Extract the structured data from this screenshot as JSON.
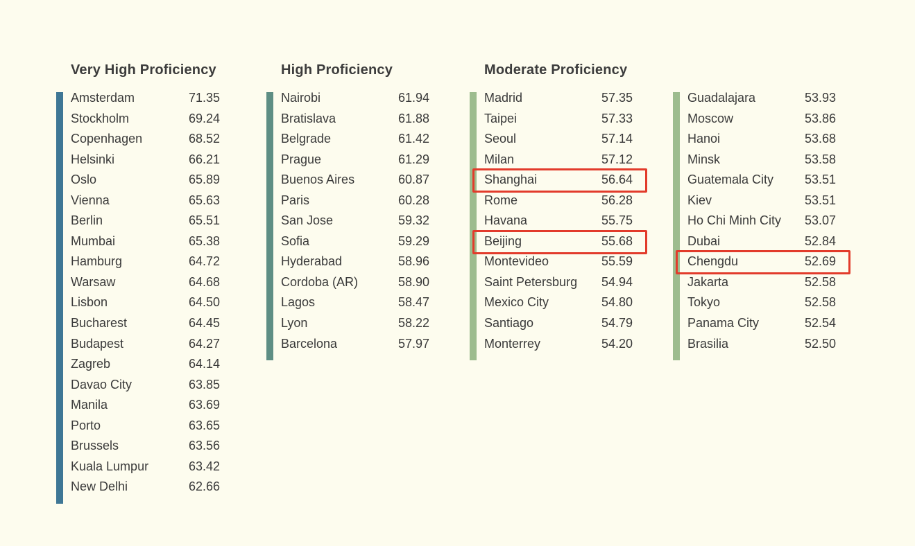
{
  "colors": {
    "very_high": "#3f7795",
    "high": "#5e8e84",
    "moderate": "#9dbc8e",
    "highlight": "#e23b2b",
    "background": "#fdfcee"
  },
  "groups": {
    "very_high": {
      "title": "Very High Proficiency",
      "rows": [
        {
          "city": "Amsterdam",
          "score": "71.35"
        },
        {
          "city": "Stockholm",
          "score": "69.24"
        },
        {
          "city": "Copenhagen",
          "score": "68.52"
        },
        {
          "city": "Helsinki",
          "score": "66.21"
        },
        {
          "city": "Oslo",
          "score": "65.89"
        },
        {
          "city": "Vienna",
          "score": "65.63"
        },
        {
          "city": "Berlin",
          "score": "65.51"
        },
        {
          "city": "Mumbai",
          "score": "65.38"
        },
        {
          "city": "Hamburg",
          "score": "64.72"
        },
        {
          "city": "Warsaw",
          "score": "64.68"
        },
        {
          "city": "Lisbon",
          "score": "64.50"
        },
        {
          "city": "Bucharest",
          "score": "64.45"
        },
        {
          "city": "Budapest",
          "score": "64.27"
        },
        {
          "city": "Zagreb",
          "score": "64.14"
        },
        {
          "city": "Davao City",
          "score": "63.85"
        },
        {
          "city": "Manila",
          "score": "63.69"
        },
        {
          "city": "Porto",
          "score": "63.65"
        },
        {
          "city": "Brussels",
          "score": "63.56"
        },
        {
          "city": "Kuala Lumpur",
          "score": "63.42"
        },
        {
          "city": "New Delhi",
          "score": "62.66"
        }
      ]
    },
    "high": {
      "title": "High Proficiency",
      "rows": [
        {
          "city": "Nairobi",
          "score": "61.94"
        },
        {
          "city": "Bratislava",
          "score": "61.88"
        },
        {
          "city": "Belgrade",
          "score": "61.42"
        },
        {
          "city": "Prague",
          "score": "61.29"
        },
        {
          "city": "Buenos Aires",
          "score": "60.87"
        },
        {
          "city": "Paris",
          "score": "60.28"
        },
        {
          "city": "San Jose",
          "score": "59.32"
        },
        {
          "city": "Sofia",
          "score": "59.29"
        },
        {
          "city": "Hyderabad",
          "score": "58.96"
        },
        {
          "city": "Cordoba (AR)",
          "score": "58.90"
        },
        {
          "city": "Lagos",
          "score": "58.47"
        },
        {
          "city": "Lyon",
          "score": "58.22"
        },
        {
          "city": "Barcelona",
          "score": "57.97"
        }
      ]
    },
    "moderate": {
      "title": "Moderate Proficiency",
      "rows_left": [
        {
          "city": "Madrid",
          "score": "57.35"
        },
        {
          "city": "Taipei",
          "score": "57.33"
        },
        {
          "city": "Seoul",
          "score": "57.14"
        },
        {
          "city": "Milan",
          "score": "57.12"
        },
        {
          "city": "Shanghai",
          "score": "56.64",
          "highlight": true
        },
        {
          "city": "Rome",
          "score": "56.28"
        },
        {
          "city": "Havana",
          "score": "55.75"
        },
        {
          "city": "Beijing",
          "score": "55.68",
          "highlight": true
        },
        {
          "city": "Montevideo",
          "score": "55.59"
        },
        {
          "city": "Saint Petersburg",
          "score": "54.94"
        },
        {
          "city": "Mexico City",
          "score": "54.80"
        },
        {
          "city": "Santiago",
          "score": "54.79"
        },
        {
          "city": "Monterrey",
          "score": "54.20"
        }
      ],
      "rows_right": [
        {
          "city": "Guadalajara",
          "score": "53.93"
        },
        {
          "city": "Moscow",
          "score": "53.86"
        },
        {
          "city": "Hanoi",
          "score": "53.68"
        },
        {
          "city": "Minsk",
          "score": "53.58"
        },
        {
          "city": "Guatemala City",
          "score": "53.51"
        },
        {
          "city": "Kiev",
          "score": "53.51"
        },
        {
          "city": "Ho Chi Minh City",
          "score": "53.07"
        },
        {
          "city": "Dubai",
          "score": "52.84"
        },
        {
          "city": "Chengdu",
          "score": "52.69",
          "highlight": true
        },
        {
          "city": "Jakarta",
          "score": "52.58"
        },
        {
          "city": "Tokyo",
          "score": "52.58"
        },
        {
          "city": "Panama City",
          "score": "52.54"
        },
        {
          "city": "Brasilia",
          "score": "52.50"
        }
      ]
    }
  }
}
